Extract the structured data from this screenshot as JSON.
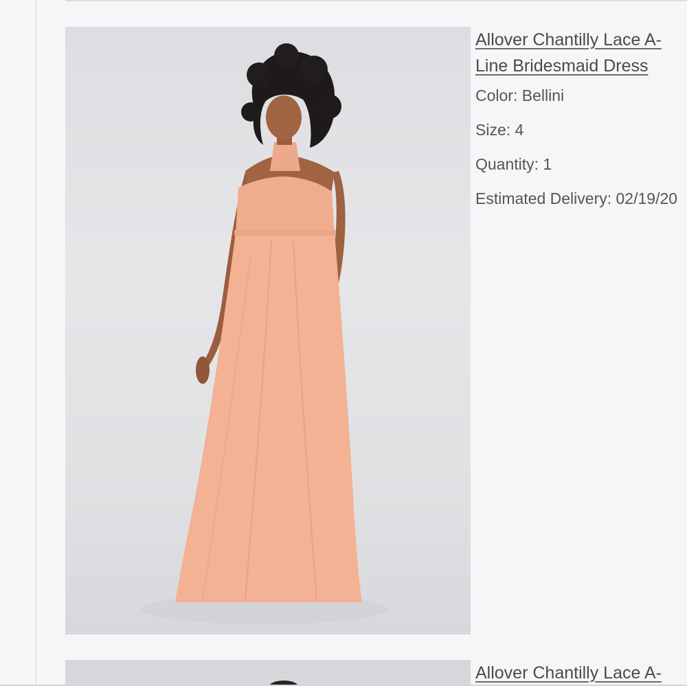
{
  "items": [
    {
      "title": "Allover Chantilly Lace A-Line Bridesmaid Dress",
      "color_line": "Color: Bellini",
      "size_line": "Size: 4",
      "quantity_line": "Quantity: 1",
      "delivery_line": "Estimated Delivery: 02/19/20"
    },
    {
      "title": "Allover Chantilly Lace A-"
    }
  ],
  "colors": {
    "background": "#f6f6f8",
    "dress": "#f2b293",
    "text": "#555555",
    "link": "#4a4a4a"
  }
}
